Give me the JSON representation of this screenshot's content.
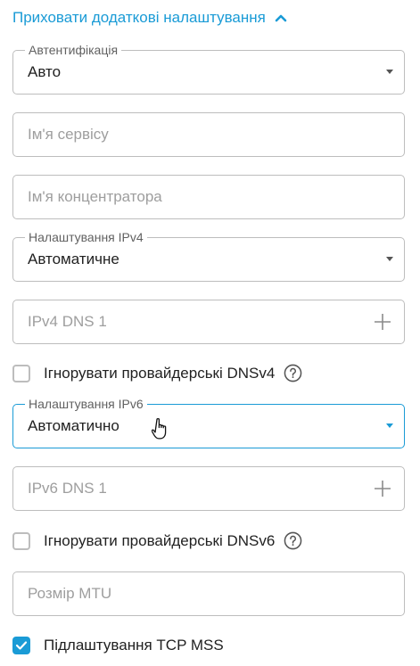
{
  "toggle": {
    "label": "Приховати додаткові налаштування"
  },
  "auth": {
    "legend": "Автентифікація",
    "value": "Авто"
  },
  "service_name": {
    "placeholder": "Ім'я сервісу"
  },
  "hub_name": {
    "placeholder": "Ім'я концентратора"
  },
  "ipv4": {
    "legend": "Налаштування IPv4",
    "value": "Автоматичне"
  },
  "ipv4_dns": {
    "placeholder": "IPv4 DNS 1"
  },
  "ignore_dnsv4": {
    "label": "Ігнорувати провайдерські DNSv4",
    "checked": false
  },
  "ipv6": {
    "legend": "Налаштування IPv6",
    "value": "Автоматично"
  },
  "ipv6_dns": {
    "placeholder": "IPv6 DNS 1"
  },
  "ignore_dnsv6": {
    "label": "Ігнорувати провайдерські DNSv6",
    "checked": false
  },
  "mtu": {
    "placeholder": "Розмір MTU"
  },
  "tcp_mss": {
    "label": "Підлаштування TCP MSS",
    "checked": true
  },
  "colors": {
    "accent": "#1a9bd6",
    "border": "#bdbdbd",
    "placeholder": "#9e9e9e"
  }
}
